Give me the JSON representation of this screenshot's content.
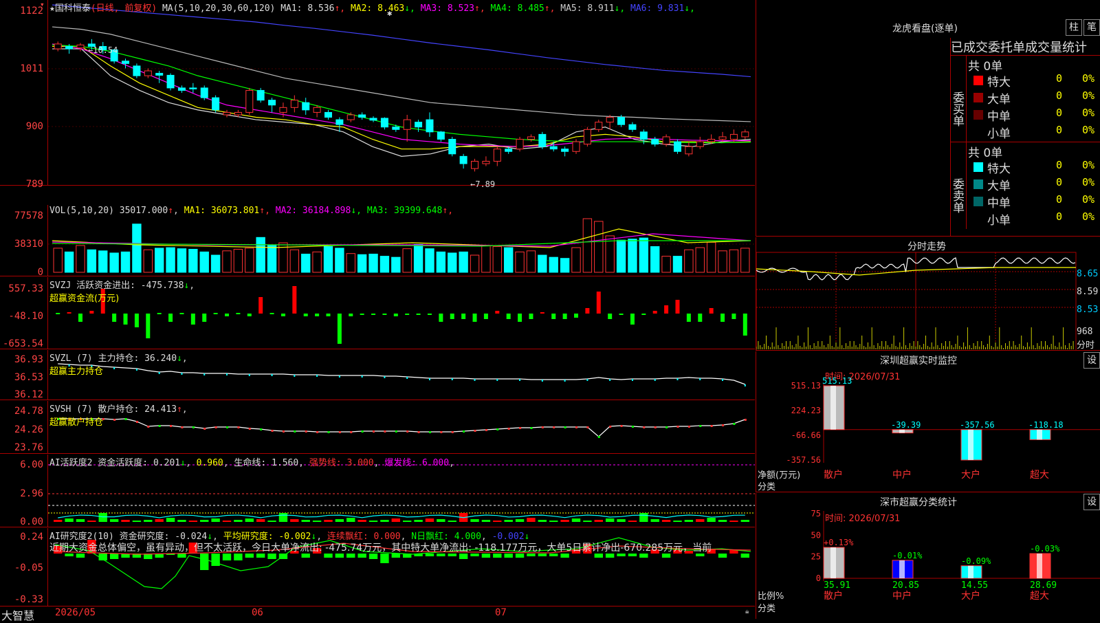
{
  "main": {
    "stock_name": "国科恒泰",
    "period": "(日线, 前复权)",
    "ma_label": "MA(5,10,20,30,60,120)",
    "ma": [
      {
        "name": "MA1: ",
        "value": "8.536",
        "arrow": "↑",
        "color": "#ddd"
      },
      {
        "name": "MA2: ",
        "value": "8.463",
        "arrow": "↓",
        "color": "#ff0"
      },
      {
        "name": "MA3: ",
        "value": "8.523",
        "arrow": "↑",
        "color": "#f0f"
      },
      {
        "name": "MA4: ",
        "value": "8.485",
        "arrow": "↑",
        "color": "#0f0"
      },
      {
        "name": "MA5: ",
        "value": "8.911",
        "arrow": "↓",
        "color": "#ccc"
      },
      {
        "name": "MA6: ",
        "value": "9.831",
        "arrow": "↓",
        "color": "#44f"
      }
    ],
    "y_labels": [
      "1122",
      "1011",
      "900",
      "789"
    ],
    "high_note": "←10.54",
    "low_note": "←7.89",
    "candles": [
      [
        10.4,
        10.5,
        10.35,
        10.55
      ],
      [
        10.45,
        10.4,
        10.3,
        10.5
      ],
      [
        10.42,
        10.48,
        10.35,
        10.52
      ],
      [
        10.5,
        10.45,
        10.38,
        10.6
      ],
      [
        10.45,
        10.38,
        10.3,
        10.54
      ],
      [
        10.38,
        10.15,
        10.1,
        10.4
      ],
      [
        10.15,
        10.1,
        10.0,
        10.2
      ],
      [
        10.05,
        9.85,
        9.8,
        10.1
      ],
      [
        9.85,
        9.95,
        9.8,
        10.0
      ],
      [
        9.9,
        9.86,
        9.7,
        9.95
      ],
      [
        9.86,
        9.6,
        9.55,
        9.9
      ],
      [
        9.6,
        9.55,
        9.5,
        9.65
      ],
      [
        9.6,
        9.58,
        9.5,
        9.7
      ],
      [
        9.6,
        9.4,
        9.35,
        9.65
      ],
      [
        9.4,
        9.15,
        9.1,
        9.45
      ],
      [
        9.05,
        9.1,
        9.0,
        9.15
      ],
      [
        9.05,
        9.1,
        9.0,
        9.15
      ],
      [
        9.1,
        9.55,
        9.05,
        9.6
      ],
      [
        9.55,
        9.35,
        9.3,
        9.6
      ],
      [
        9.35,
        9.25,
        9.1,
        9.4
      ],
      [
        9.1,
        9.2,
        9.0,
        9.3
      ],
      [
        9.2,
        9.35,
        9.1,
        9.45
      ],
      [
        9.3,
        9.15,
        9.05,
        9.4
      ],
      [
        9.1,
        9.2,
        9.0,
        9.25
      ],
      [
        9.1,
        9.0,
        8.95,
        9.15
      ],
      [
        8.95,
        8.85,
        8.7,
        9.0
      ],
      [
        8.95,
        9.05,
        8.9,
        9.1
      ],
      [
        9.05,
        9.0,
        8.95,
        9.1
      ],
      [
        8.98,
        8.94,
        8.9,
        9.02
      ],
      [
        8.98,
        8.8,
        8.75,
        9.0
      ],
      [
        8.8,
        8.75,
        8.7,
        8.85
      ],
      [
        8.75,
        8.95,
        8.5,
        9.05
      ],
      [
        8.9,
        8.8,
        8.7,
        8.95
      ],
      [
        8.95,
        8.7,
        8.6,
        9.1
      ],
      [
        8.7,
        8.55,
        8.5,
        8.72
      ],
      [
        8.55,
        8.25,
        8.2,
        8.6
      ],
      [
        8.2,
        8.05,
        7.95,
        8.25
      ],
      [
        7.95,
        8.1,
        7.89,
        8.15
      ],
      [
        8.05,
        8.1,
        8.0,
        8.2
      ],
      [
        8.1,
        8.35,
        8.0,
        8.4
      ],
      [
        8.35,
        8.3,
        8.25,
        8.4
      ],
      [
        8.35,
        8.55,
        8.3,
        8.6
      ],
      [
        8.55,
        8.6,
        8.5,
        8.65
      ],
      [
        8.65,
        8.4,
        8.35,
        8.7
      ],
      [
        8.4,
        8.35,
        8.3,
        8.5
      ],
      [
        8.35,
        8.3,
        8.2,
        8.4
      ],
      [
        8.3,
        8.5,
        8.25,
        8.55
      ],
      [
        8.45,
        8.75,
        8.4,
        8.8
      ],
      [
        8.75,
        8.9,
        8.7,
        8.95
      ],
      [
        8.9,
        9.0,
        8.75,
        9.05
      ],
      [
        9.0,
        8.85,
        8.8,
        9.05
      ],
      [
        8.85,
        8.75,
        8.7,
        8.9
      ],
      [
        8.7,
        8.55,
        8.45,
        8.75
      ],
      [
        8.55,
        8.45,
        8.4,
        8.6
      ],
      [
        8.45,
        8.6,
        8.4,
        8.65
      ],
      [
        8.5,
        8.3,
        8.25,
        8.55
      ],
      [
        8.25,
        8.4,
        8.2,
        8.5
      ],
      [
        8.4,
        8.5,
        8.35,
        8.6
      ],
      [
        8.5,
        8.55,
        8.45,
        8.65
      ],
      [
        8.55,
        8.6,
        8.5,
        8.7
      ],
      [
        8.55,
        8.65,
        8.5,
        8.75
      ],
      [
        8.6,
        8.7,
        8.55,
        8.75
      ]
    ],
    "price_range": [
      7.6,
      11.4
    ]
  },
  "vol": {
    "header": "VOL(5,10,20) ",
    "value": "35017.000",
    "ma": [
      {
        "name": "MA1: ",
        "value": "36073.801",
        "arrow": "↑",
        "color": "#ff0"
      },
      {
        "name": "MA2: ",
        "value": "36184.898",
        "arrow": "↓",
        "color": "#f0f"
      },
      {
        "name": "MA3: ",
        "value": "39399.648",
        "arrow": "↑",
        "color": "#0f0"
      }
    ],
    "y_labels": [
      "77578",
      "38310",
      "0"
    ]
  },
  "svzj": {
    "header": "SVZJ  活跃资金进出: ",
    "value": "-475.738",
    "arrow": "↓",
    "sub": "超赢资金流(万元)",
    "y_labels": [
      "557.33",
      "-48.10",
      "-653.54"
    ]
  },
  "svzl": {
    "header": "SVZL (7) 主力持仓: ",
    "value": "36.240",
    "arrow": "↓",
    "sub": "超赢主力持仓",
    "y_labels": [
      "36.93",
      "36.53",
      "36.12"
    ]
  },
  "svsh": {
    "header": "SVSH (7) 散户持仓: ",
    "value": "24.413",
    "arrow": "↑",
    "sub": "超赢散户持仓",
    "y_labels": [
      "24.78",
      "24.26",
      "23.76"
    ]
  },
  "ai1": {
    "header": "AI活跃度2 资金活跃度: ",
    "v1": "0.201",
    "v2": "0.960",
    "life_label": "生命线: ",
    "life": "1.560",
    "strong_label": "强势线: ",
    "strong": "3.000",
    "burst_label": "爆发线: ",
    "burst": "6.000",
    "y_labels": [
      "6.00",
      "2.96",
      "0.00"
    ]
  },
  "ai2": {
    "header": "AI研究度2(10) 资金研究度: ",
    "v1": "-0.024",
    "avg_label": "平均研究度: ",
    "avg": "-0.002",
    "red_label": "连续飘红: ",
    "red": "0.000",
    "nday_label": "N日飘红: ",
    "nday": "4.000",
    "nday2": "-0.002",
    "note": "近期大资金总体偏空，虽有异动，但不太活跃，今日大单净流出: -475.74万元，其中特大单净流出: -118.177万元，大单5日累计净出-670.285万元，当前",
    "y_labels": [
      "0.24",
      "-0.05",
      "-0.33"
    ]
  },
  "bottom": {
    "brand": "大智慧",
    "dates": [
      "2026/05",
      "06",
      "07"
    ]
  },
  "right": {
    "title": "龙虎看盘(逐单)",
    "btn1": "柱",
    "btn2": "笔",
    "tabs": "已成交委托单成交量统计",
    "buy_total": "共 0单",
    "buy_label": "委买单",
    "sell_total": "共 0单",
    "sell_label": "委卖单",
    "buy_rows": [
      {
        "name": "特大",
        "v1": "0",
        "v2": "0%",
        "color": "#f00"
      },
      {
        "name": "大单",
        "v1": "0",
        "v2": "0%",
        "color": "#900"
      },
      {
        "name": "中单",
        "v1": "0",
        "v2": "0%",
        "color": "#600"
      },
      {
        "name": "小单",
        "v1": "0",
        "v2": "0%",
        "color": "#000"
      }
    ],
    "sell_rows": [
      {
        "name": "特大",
        "v1": "0",
        "v2": "0%",
        "color": "#0ff"
      },
      {
        "name": "大单",
        "v1": "0",
        "v2": "0%",
        "color": "#088"
      },
      {
        "name": "中单",
        "v1": "0",
        "v2": "0%",
        "color": "#066"
      },
      {
        "name": "小单",
        "v1": "0",
        "v2": "0%",
        "color": "#000"
      }
    ],
    "intraday_title": "分时走势",
    "intraday_labels": [
      "8.65",
      "8.59",
      "8.53",
      "968"
    ],
    "intraday_unit": "分时",
    "monitor_title": "深圳超赢实时监控",
    "monitor_btn": "设",
    "monitor_time": "时间: 2026/07/31",
    "monitor_y": [
      "515.13",
      "224.23",
      "-66.66",
      "-357.56"
    ],
    "monitor_unit": "净额(万元)",
    "monitor_cat": "分类",
    "monitor_chart": {
      "type": "bar",
      "categories": [
        "散户",
        "中户",
        "大户",
        "超大"
      ],
      "values": [
        515.13,
        -39.39,
        -357.56,
        -118.18
      ],
      "ylim": [
        -357.56,
        515.13
      ]
    },
    "stats_title": "深市超赢分类统计",
    "stats_btn": "设",
    "stats_time": "时间: 2026/07/31",
    "stats_y": [
      "75",
      "50",
      "25",
      "0"
    ],
    "stats_unit": "比例%",
    "stats_cat": "分类",
    "stats_chart": {
      "type": "bar",
      "categories": [
        "散户",
        "中户",
        "大户",
        "超大"
      ],
      "values": [
        35.91,
        20.85,
        14.55,
        28.69
      ],
      "changes": [
        "+0.13%",
        "-0.01%",
        "-0.09%",
        "-0.03%"
      ],
      "ylim": [
        0,
        75
      ]
    }
  }
}
